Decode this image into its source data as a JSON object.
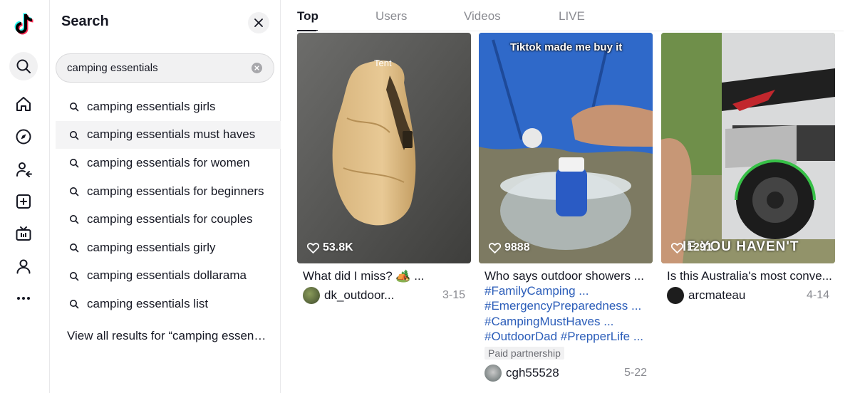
{
  "rail": {
    "items": [
      {
        "icon": "search-icon"
      },
      {
        "icon": "home-icon"
      },
      {
        "icon": "explore-compass-icon"
      },
      {
        "icon": "following-icon"
      },
      {
        "icon": "upload-icon"
      },
      {
        "icon": "live-tv-icon"
      },
      {
        "icon": "profile-icon"
      },
      {
        "icon": "more-icon"
      }
    ]
  },
  "search_panel": {
    "title": "Search",
    "query": "camping essentials",
    "suggestions": [
      "camping essentials girls",
      "camping essentials must haves",
      "camping essentials for women",
      "camping essentials for beginners",
      "camping essentials for couples",
      "camping essentials girly",
      "camping essentials dollarama",
      "camping essentials list"
    ],
    "view_all": "View all results for “camping essentials”"
  },
  "tabs": [
    "Top",
    "Users",
    "Videos",
    "LIVE"
  ],
  "videos": [
    {
      "overlay": "Tent",
      "likes": "53.8K",
      "caption": "What did I miss? 🏕️ ...",
      "hashtags": [],
      "author": "dk_outdoor...",
      "date": "3-15"
    },
    {
      "overlay": "Tiktok made me buy it",
      "likes": "9888",
      "caption": "Who says outdoor showers ...",
      "hashtags": [
        "#FamilyCamping ...",
        "#EmergencyPreparedness ...",
        "#CampingMustHaves ...",
        "#OutdoorDad #PrepperLife ..."
      ],
      "badge": "Paid partnership",
      "author": "cgh55528",
      "date": "5-22"
    },
    {
      "overlay": "IF YOU HAVEN'T",
      "likes": "1291",
      "caption": "Is this Australia's most conve...",
      "hashtags": [],
      "author": "arcmateau",
      "date": "4-14"
    }
  ],
  "colors": {
    "accent_link": "#2b5db9",
    "text_primary": "#161823",
    "text_secondary": "#8a8b91"
  }
}
